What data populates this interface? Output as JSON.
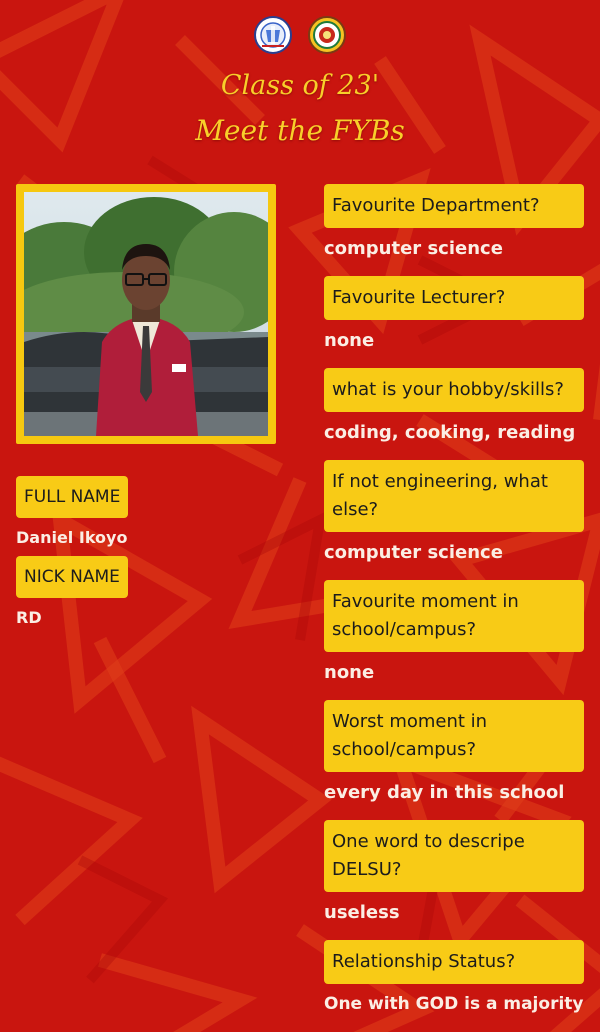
{
  "header": {
    "title_line1": "Class of 23'",
    "title_line2": "Meet the FYBs",
    "logos": [
      "university-crest-icon",
      "society-seal-icon"
    ]
  },
  "profile": {
    "full_name_label": "FULL NAME",
    "full_name": "Daniel Ikoyo",
    "nick_name_label": "NICK NAME",
    "nick_name": "RD"
  },
  "qa": [
    {
      "question": "Favourite Department?",
      "answer": "computer science"
    },
    {
      "question": "Favourite Lecturer?",
      "answer": "none"
    },
    {
      "question": "what is your hobby/skills?",
      "answer": "coding, cooking, reading"
    },
    {
      "question": "If not engineering, what else?",
      "answer": "computer science"
    },
    {
      "question": "Favourite moment in school/campus?",
      "answer": "none"
    },
    {
      "question": "Worst moment in school/campus?",
      "answer": "every day in this school"
    },
    {
      "question": "One word to descripe DELSU?",
      "answer": "useless"
    },
    {
      "question": "Relationship Status?",
      "answer": "One with GOD is a majority"
    }
  ],
  "colors": {
    "background": "#c8140e",
    "accent_yellow": "#f8cb16",
    "title_gold": "#f8cf2a",
    "answer_text": "#fbeee4"
  }
}
